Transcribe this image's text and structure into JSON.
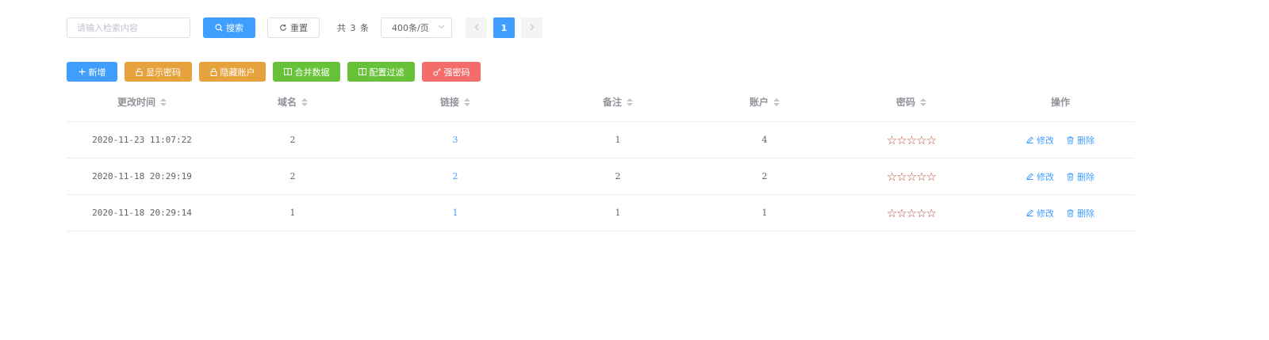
{
  "search": {
    "placeholder": "请输入检索内容",
    "value": ""
  },
  "toolbar": {
    "search_label": "搜索",
    "reset_label": "重置",
    "total_text": "共 3 条",
    "page_size": "400条/页",
    "current_page": "1"
  },
  "actions": {
    "add": "新增",
    "show_password": "显示密码",
    "hide_account": "隐藏账户",
    "merge_data": "合并数据",
    "config_filter": "配置过滤",
    "strong_password": "强密码"
  },
  "table": {
    "headers": {
      "time": "更改时间",
      "domain": "域名",
      "link": "链接",
      "note": "备注",
      "account": "账户",
      "password": "密码",
      "ops": "操作"
    },
    "rows": [
      {
        "time": "2020-11-23 11:07:22",
        "domain": "2",
        "link": "3",
        "note": "1",
        "account": "4",
        "password": "☆☆☆☆☆"
      },
      {
        "time": "2020-11-18 20:29:19",
        "domain": "2",
        "link": "2",
        "note": "2",
        "account": "2",
        "password": "☆☆☆☆☆"
      },
      {
        "time": "2020-11-18 20:29:14",
        "domain": "1",
        "link": "1",
        "note": "1",
        "account": "1",
        "password": "☆☆☆☆☆"
      }
    ],
    "edit_label": "修改",
    "delete_label": "删除"
  },
  "colors": {
    "primary": "#409eff",
    "warning": "#e6a23c",
    "success": "#67c23a",
    "danger": "#f56c6c",
    "stars": "#b94a3b"
  }
}
